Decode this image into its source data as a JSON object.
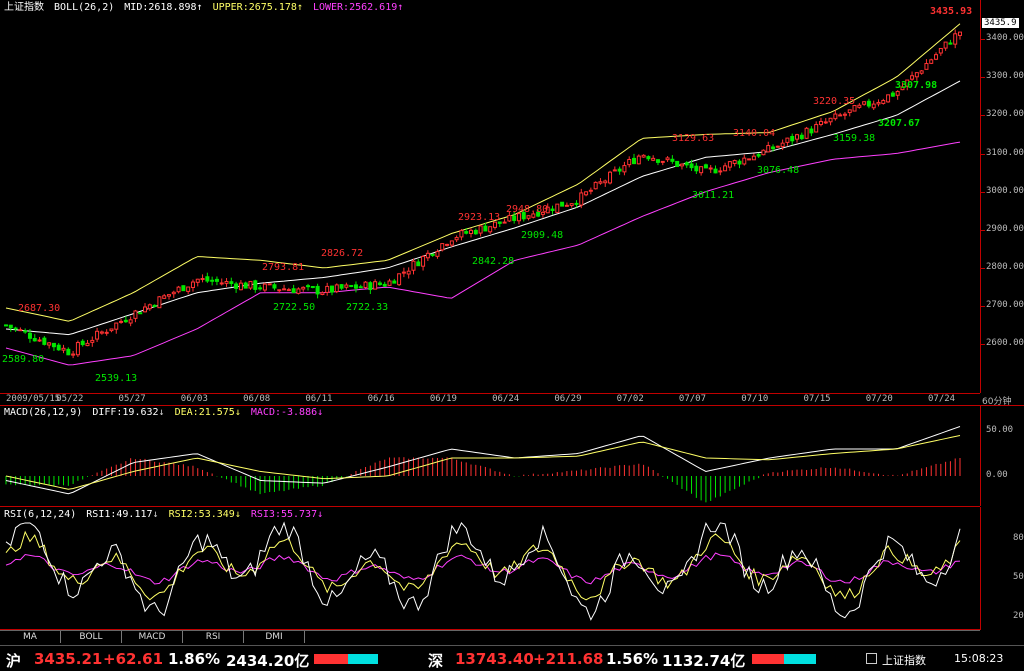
{
  "main": {
    "title": "上证指数",
    "indicator": "BOLL(26,2)",
    "mid": "MID:2618.898",
    "upper": "UPPER:2675.178",
    "lower": "LOWER:2562.619",
    "current_price_tag": "3435.9",
    "price_labels": [
      {
        "text": "3435.93",
        "color": "red"
      },
      {
        "text": "3307.98",
        "color": "green"
      },
      {
        "text": "3207.67",
        "color": "green"
      },
      {
        "text": "3220.35",
        "color": "red"
      },
      {
        "text": "3159.38",
        "color": "green"
      },
      {
        "text": "3140.04",
        "color": "red"
      },
      {
        "text": "3076.48",
        "color": "green"
      },
      {
        "text": "3129.63",
        "color": "red"
      },
      {
        "text": "3011.21",
        "color": "green"
      },
      {
        "text": "2923.13",
        "color": "red"
      },
      {
        "text": "2948.80",
        "color": "red"
      },
      {
        "text": "2909.48",
        "color": "green"
      },
      {
        "text": "2842.28",
        "color": "green"
      },
      {
        "text": "2826.72",
        "color": "red"
      },
      {
        "text": "2793.81",
        "color": "red"
      },
      {
        "text": "2722.50",
        "color": "green"
      },
      {
        "text": "2722.33",
        "color": "green"
      },
      {
        "text": "2687.30",
        "color": "red"
      },
      {
        "text": "2589.80",
        "color": "green"
      },
      {
        "text": "2539.13",
        "color": "green"
      }
    ],
    "y_ticks": [
      "3400.00",
      "3300.00",
      "3200.00",
      "3100.00",
      "3000.00",
      "2900.00",
      "2800.00",
      "2700.00",
      "2600.00"
    ],
    "dates": [
      "2009/05/15",
      "05/22",
      "05/27",
      "06/03",
      "06/08",
      "06/11",
      "06/16",
      "06/19",
      "06/24",
      "06/29",
      "07/02",
      "07/07",
      "07/10",
      "07/15",
      "07/20",
      "07/24"
    ],
    "period": "60分钟"
  },
  "macd": {
    "name": "MACD(26,12,9)",
    "diff": "DIFF:19.632",
    "dea": "DEA:21.575",
    "macd": "MACD:-3.886",
    "y_ticks": [
      "50.00",
      "0.00"
    ]
  },
  "rsi": {
    "name": "RSI(6,12,24)",
    "rsi1": "RSI1:49.117",
    "rsi2": "RSI2:53.349",
    "rsi3": "RSI3:55.737",
    "y_ticks": [
      "80",
      "50",
      "20"
    ]
  },
  "tabs": [
    "MA",
    "BOLL",
    "MACD",
    "RSI",
    "DMI"
  ],
  "status": {
    "sh_label": "沪",
    "sh_price": "3435.21",
    "sh_change": "+62.61",
    "sh_pct": "1.86%",
    "sh_amount": "2434.20亿",
    "sz_label": "深",
    "sz_price": "13743.40",
    "sz_change": "+211.68",
    "sz_pct": "1.56%",
    "sz_amount": "1132.74亿",
    "index_name": "上证指数",
    "time": "15:08:23"
  },
  "colors": {
    "up": "#ff3232",
    "down": "#00e600",
    "mid": "#ffffff",
    "upper": "#ffff66",
    "lower": "#ff40ff",
    "diff": "#ffffff",
    "dea": "#ffff66"
  },
  "chart_data": {
    "type": "line",
    "title": "上证指数",
    "x": [
      "2009/05/15",
      "05/22",
      "05/27",
      "06/03",
      "06/08",
      "06/11",
      "06/16",
      "06/19",
      "06/24",
      "06/29",
      "07/02",
      "07/07",
      "07/10",
      "07/15",
      "07/20",
      "07/24"
    ],
    "ylim": [
      2500,
      3460
    ],
    "series": [
      {
        "name": "MID",
        "values": [
          2640,
          2625,
          2680,
          2735,
          2760,
          2775,
          2800,
          2855,
          2905,
          2960,
          3040,
          3090,
          3105,
          3150,
          3200,
          3290
        ]
      },
      {
        "name": "UPPER",
        "values": [
          2695,
          2660,
          2735,
          2830,
          2820,
          2800,
          2820,
          2890,
          2940,
          3020,
          3140,
          3150,
          3155,
          3210,
          3300,
          3440
        ]
      },
      {
        "name": "LOWER",
        "values": [
          2590,
          2545,
          2570,
          2640,
          2735,
          2735,
          2750,
          2720,
          2820,
          2860,
          2935,
          3000,
          3050,
          3085,
          3100,
          3130
        ]
      }
    ],
    "close": [
      2650,
      2580,
      2680,
      2770,
      2750,
      2740,
      2760,
      2880,
      2930,
      2980,
      3100,
      3050,
      3110,
      3190,
      3260,
      3420
    ]
  }
}
